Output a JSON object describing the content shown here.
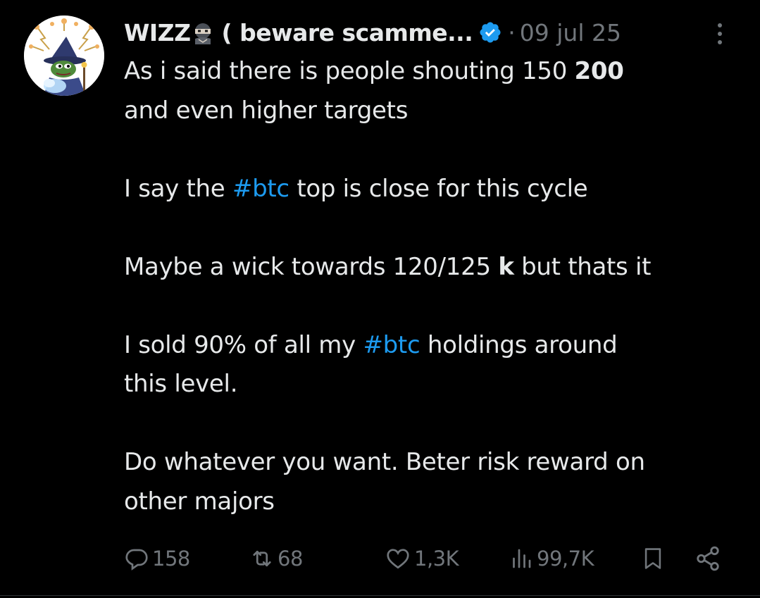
{
  "tweet": {
    "author": {
      "display_name": "WIZZ",
      "display_name_tail": "( beware scamme...",
      "avatar_icon": "wizard-avatar-icon",
      "name_emoji_icon": "ninja-emoji-icon",
      "verified_icon": "verified-badge-icon",
      "verified_color": "#1d9bf0"
    },
    "separator": "·",
    "timestamp": "09 jul 25",
    "more_icon": "more-vertical-icon",
    "text": {
      "line1_pre": "As i said there is people shouting 150 ",
      "line1_bold": "200",
      "line2": "and even higher targets",
      "line3_pre": "I say the ",
      "line3_tag": "#btc",
      "line3_post": " top is close for this cycle",
      "line4_pre": "Maybe a wick towards 120/125 ",
      "line4_bold": "k",
      "line4_post": " but thats it",
      "line5_pre": "I sold 90% of all my ",
      "line5_tag": "#btc",
      "line5_post": " holdings around",
      "line6": "this level.",
      "line7": "Do whatever you want. Beter risk reward on",
      "line8": "other majors"
    },
    "actions": {
      "replies": "158",
      "reposts": "68",
      "likes": "1,3K",
      "views": "99,7K",
      "reply_icon": "reply-icon",
      "repost_icon": "repost-icon",
      "like_icon": "heart-icon",
      "views_icon": "views-chart-icon",
      "bookmark_icon": "bookmark-icon",
      "share_icon": "share-icon"
    },
    "colors": {
      "background": "#000000",
      "text": "#e7e9ea",
      "muted": "#71767b",
      "hashtag": "#1d9bf0"
    }
  }
}
